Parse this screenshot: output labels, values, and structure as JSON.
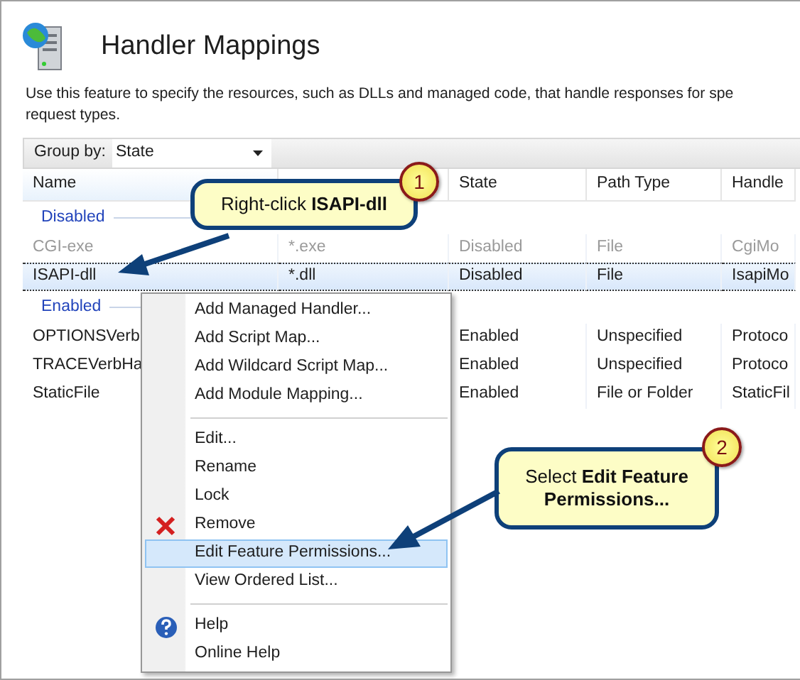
{
  "page": {
    "title": "Handler Mappings",
    "description_lines": [
      "Use this feature to specify the resources, such as DLLs and managed code, that handle responses for spe",
      "request types."
    ]
  },
  "toolbar": {
    "label": "Group by:",
    "value": "State"
  },
  "table": {
    "columns": [
      "Name",
      "",
      "State",
      "Path Type",
      "Handle"
    ],
    "groups": [
      {
        "label": "Disabled",
        "rows": [
          {
            "cells": [
              "CGI-exe",
              "*.exe",
              "Disabled",
              "File",
              "CgiMo"
            ],
            "dimmed": true,
            "selected": false
          },
          {
            "cells": [
              "ISAPI-dll",
              "*.dll",
              "Disabled",
              "File",
              "IsapiMo"
            ],
            "dimmed": false,
            "selected": true
          }
        ]
      },
      {
        "label": "Enabled",
        "rows": [
          {
            "cells": [
              "OPTIONSVerb",
              "",
              "Enabled",
              "Unspecified",
              "Protoco"
            ],
            "dimmed": false,
            "selected": false
          },
          {
            "cells": [
              "TRACEVerbHa",
              "",
              "Enabled",
              "Unspecified",
              "Protoco"
            ],
            "dimmed": false,
            "selected": false
          },
          {
            "cells": [
              "StaticFile",
              "",
              "Enabled",
              "File or Folder",
              "StaticFil"
            ],
            "dimmed": false,
            "selected": false
          }
        ]
      }
    ]
  },
  "context_menu": {
    "items": [
      {
        "kind": "item",
        "label": "Add Managed Handler...",
        "selected": false
      },
      {
        "kind": "item",
        "label": "Add Script Map...",
        "selected": false
      },
      {
        "kind": "item",
        "label": "Add Wildcard Script Map...",
        "selected": false
      },
      {
        "kind": "item",
        "label": "Add Module Mapping...",
        "selected": false
      },
      {
        "kind": "separator"
      },
      {
        "kind": "item",
        "label": "Edit...",
        "selected": false
      },
      {
        "kind": "item",
        "label": "Rename",
        "selected": false
      },
      {
        "kind": "item",
        "label": "Lock",
        "selected": false
      },
      {
        "kind": "delete",
        "label": "Remove",
        "selected": false
      },
      {
        "kind": "item",
        "label": "Edit Feature Permissions...",
        "selected": true
      },
      {
        "kind": "item",
        "label": "View Ordered List...",
        "selected": false
      },
      {
        "kind": "separator"
      },
      {
        "kind": "help",
        "label": "Help",
        "selected": false
      },
      {
        "kind": "item",
        "label": "Online Help",
        "selected": false
      }
    ]
  },
  "callouts": [
    {
      "number": "1",
      "text": "Right-click **ISAPI-dll**"
    },
    {
      "number": "2",
      "text": "Select **Edit Feature Permissions...**"
    }
  ]
}
